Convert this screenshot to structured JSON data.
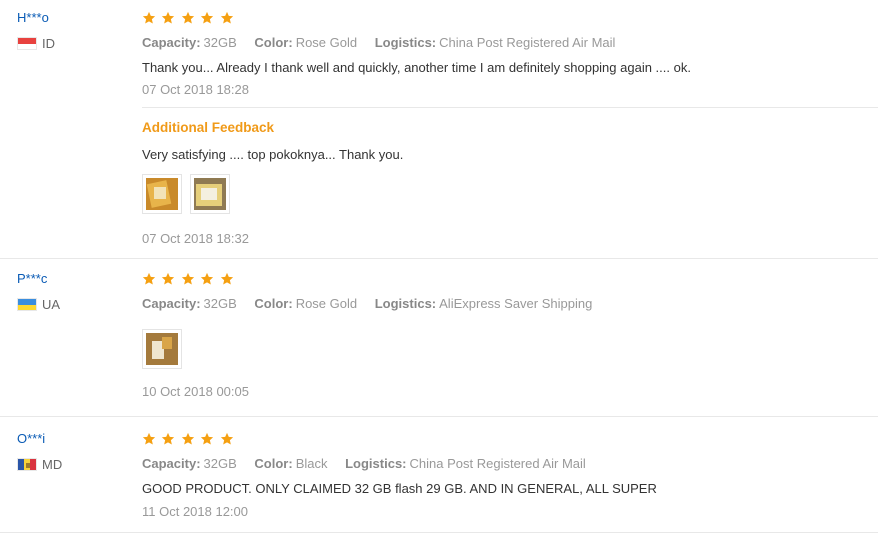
{
  "labels": {
    "capacity": "Capacity:",
    "color": "Color:",
    "logistics": "Logistics:",
    "additional_feedback": "Additional Feedback"
  },
  "colors": {
    "star": "#f5a012",
    "username": "#0a5bb5",
    "additional_feedback": "#f09a19",
    "divider": "#e8e8e8"
  },
  "reviews": [
    {
      "user": "H***o",
      "country": "ID",
      "flag_icon": "flag-indonesia-icon",
      "rating": 5,
      "capacity": "32GB",
      "color": "Rose Gold",
      "logistics": "China Post Registered Air Mail",
      "text": "Thank you... Already I thank well and quickly, another time I am definitely shopping again .... ok.",
      "date": "07 Oct 2018 18:28",
      "additional": {
        "text": "Very satisfying .... top pokoknya... Thank you.",
        "photos": [
          "photo-thumbnail",
          "photo-thumbnail"
        ],
        "date": "07 Oct 2018 18:32"
      }
    },
    {
      "user": "P***c",
      "country": "UA",
      "flag_icon": "flag-ukraine-icon",
      "rating": 5,
      "capacity": "32GB",
      "color": "Rose Gold",
      "logistics": "AliExpress Saver Shipping",
      "photos": [
        "photo-thumbnail"
      ],
      "date": "10 Oct 2018 00:05"
    },
    {
      "user": "O***i",
      "country": "MD",
      "flag_icon": "flag-moldova-icon",
      "rating": 5,
      "capacity": "32GB",
      "color": "Black",
      "logistics": "China Post Registered Air Mail",
      "text": "GOOD PRODUCT. ONLY CLAIMED 32 GB flash 29 GB. AND IN GENERAL, ALL SUPER",
      "date": "11 Oct 2018 12:00"
    }
  ]
}
